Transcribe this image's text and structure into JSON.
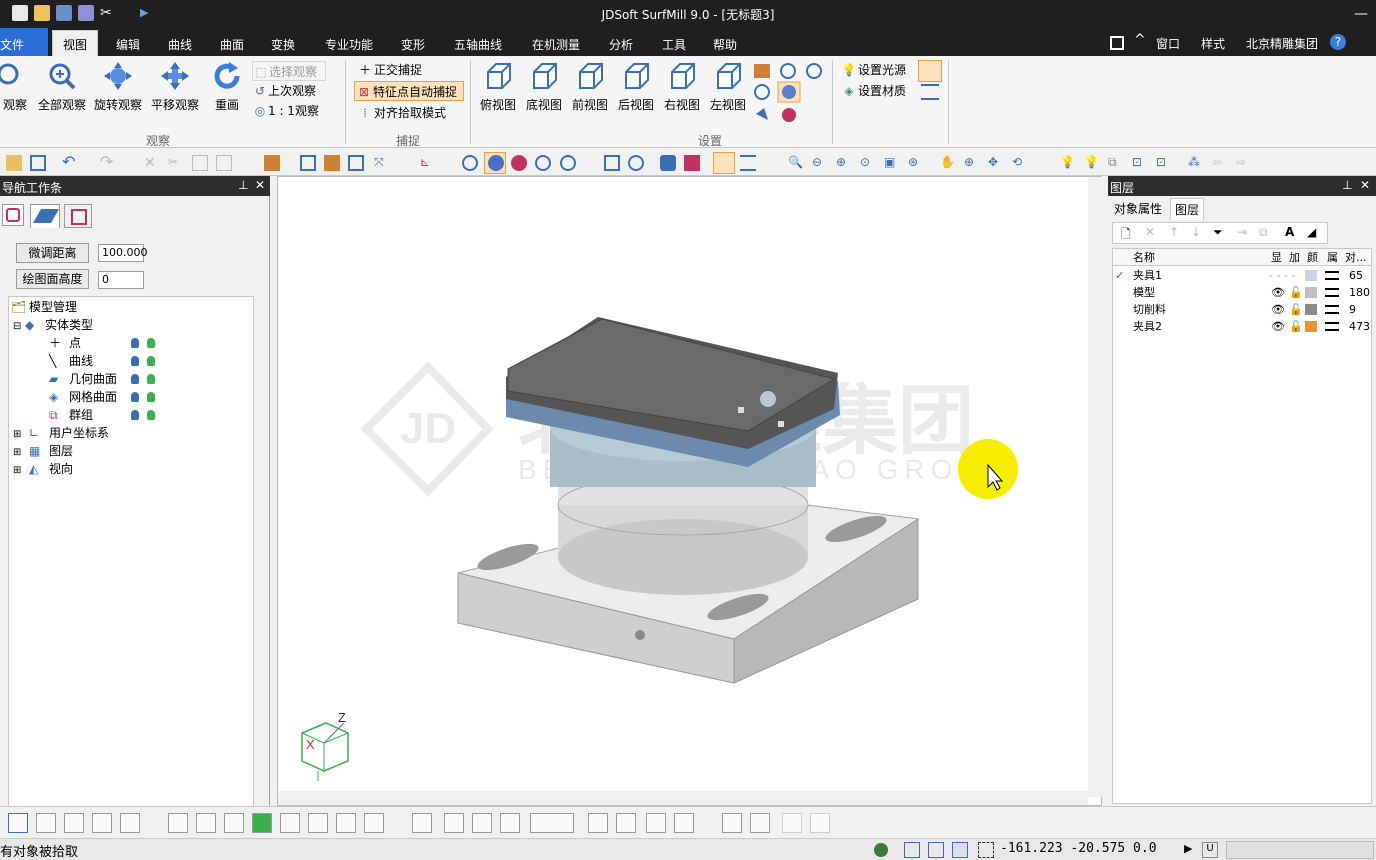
{
  "window": {
    "title": "JDSoft SurfMill 9.0 - [无标题3]"
  },
  "menubar": {
    "file": "文件",
    "items": [
      "视图",
      "编辑",
      "曲线",
      "曲面",
      "变换",
      "专业功能",
      "变形",
      "五轴曲线",
      "在机测量",
      "分析",
      "工具",
      "帮助"
    ],
    "right": {
      "window": "窗口",
      "style": "样式",
      "company": "北京精雕集团",
      "help": "?"
    }
  },
  "ribbon": {
    "observe_buttons": [
      "观察",
      "全部观察",
      "旋转观察",
      "平移观察",
      "重画"
    ],
    "observe_small": [
      "选择观察",
      "上次观察",
      "1 : 1观察"
    ],
    "observe_group": "观察",
    "snap_items": [
      "正交捕捉",
      "特征点自动捕捉",
      "对齐拾取模式"
    ],
    "snap_group": "捕捉",
    "view_buttons": [
      "俯视图",
      "底视图",
      "前视图",
      "后视图",
      "右视图",
      "左视图"
    ],
    "settings_items": [
      "设置光源",
      "设置材质"
    ],
    "settings_group": "设置"
  },
  "left_panel": {
    "title": "导航工作条",
    "fine_label": "微调距离",
    "fine_value": "100.000",
    "draw_label": "绘图面高度",
    "draw_value": "0",
    "tree": {
      "root": "模型管理",
      "entity": "实体类型",
      "children": [
        "点",
        "曲线",
        "几何曲面",
        "网格曲面",
        "群组"
      ],
      "others": [
        "用户坐标系",
        "图层",
        "视向"
      ]
    }
  },
  "right_panel": {
    "title": "图层",
    "tabs": [
      "对象属性",
      "图层"
    ],
    "columns": [
      "名称",
      "显",
      "加",
      "颜",
      "属",
      "对..."
    ],
    "rows": [
      {
        "name": "夹具1",
        "count": "65",
        "color": "#c9d3e3"
      },
      {
        "name": "模型",
        "count": "180",
        "color": "#c0c0c0"
      },
      {
        "name": "切削料",
        "count": "9",
        "color": "#8a8a8a"
      },
      {
        "name": "夹具2",
        "count": "473",
        "color": "#e8922e"
      }
    ]
  },
  "viewport": {
    "watermark_logo": "JD",
    "watermark_cn": "北京精雕集团",
    "watermark_en": "BEIJING JINGDIAO GROUP",
    "axis_z": "Z",
    "axis_x": "X"
  },
  "status": {
    "message": "有对象被拾取",
    "coords": "-161.223  -20.575  0.0"
  },
  "colors": {
    "accent": "#2b6fd6",
    "dark": "#1f1f1f",
    "highlight": "#fde1b9"
  }
}
